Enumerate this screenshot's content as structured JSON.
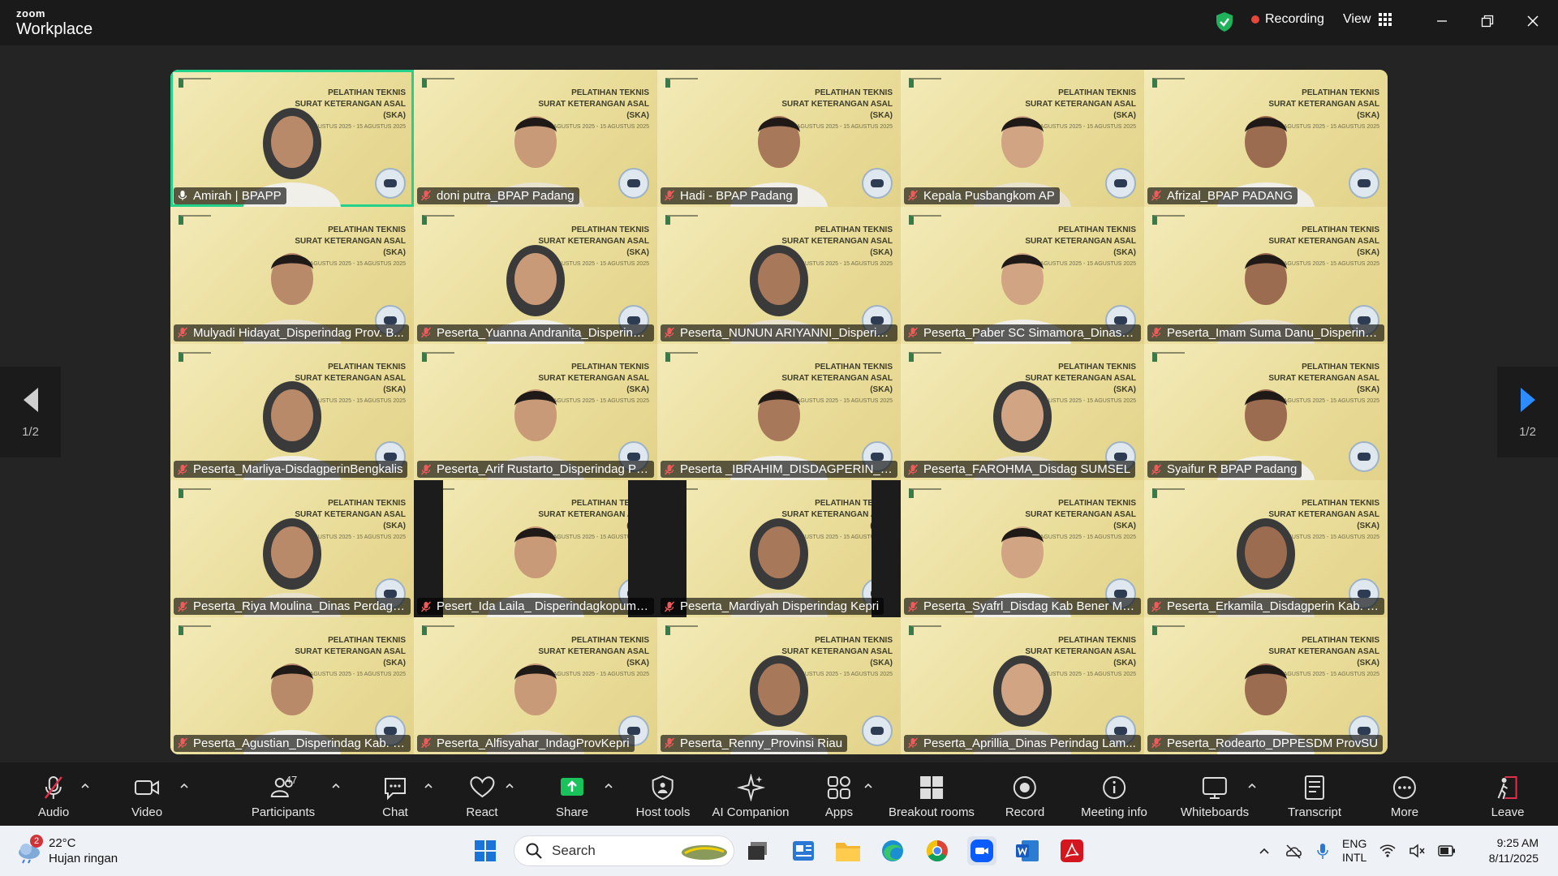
{
  "app": {
    "brand_top": "zoom",
    "brand_bottom": "Workplace"
  },
  "header": {
    "recording_label": "Recording",
    "view_label": "View"
  },
  "pager": {
    "left": "1/2",
    "right": "1/2"
  },
  "participants": [
    {
      "name": "Amirah | BPAPP",
      "speaking": true
    },
    {
      "name": "doni putra_BPAP Padang"
    },
    {
      "name": "Hadi - BPAP Padang"
    },
    {
      "name": "Kepala Pusbangkom AP"
    },
    {
      "name": "Afrizal_BPAP PADANG"
    },
    {
      "name": "Mulyadi Hidayat_Disperindag Prov. B..."
    },
    {
      "name": "Peserta_Yuanna Andranita_Disperind..."
    },
    {
      "name": "Peserta_NUNUN ARIYANNI_Disperin..."
    },
    {
      "name": "Peserta_Paber SC Simamora_Dinas K..."
    },
    {
      "name": "Peserta_Imam Suma Danu_Disperind..."
    },
    {
      "name": "Peserta_Marliya-DisdagperinBengkalis"
    },
    {
      "name": "Peserta_Arif Rustarto_Disperindag Pr..."
    },
    {
      "name": "Peserta _IBRAHIM_DISDAGPERIN_KA..."
    },
    {
      "name": "Peserta_FAROHMA_Disdag SUMSEL"
    },
    {
      "name": "Syaifur R BPAP Padang"
    },
    {
      "name": "Peserta_Riya Moulina_Dinas Perdagk..."
    },
    {
      "name": "Pesert_Ida Laila_ Disperindagkopum ..."
    },
    {
      "name": "Peserta_Mardiyah Disperindag Kepri"
    },
    {
      "name": "Peserta_Syafrl_Disdag Kab Bener Mer..."
    },
    {
      "name": "Peserta_Erkamila_Disdagperin Kab. B..."
    },
    {
      "name": "Peserta_Agustian_Disperindag Kab. Natu..."
    },
    {
      "name": "Peserta_Alfisyahar_IndagProvKepri"
    },
    {
      "name": "Peserta_Renny_Provinsi Riau"
    },
    {
      "name": "Peserta_Aprillia_Dinas Perindag Lam..."
    },
    {
      "name": "Peserta_Rodearto_DPPESDM ProvSU"
    }
  ],
  "banner": {
    "l1": "PELATIHAN TEKNIS",
    "l2": "SURAT KETERANGAN ASAL",
    "l3": "(SKA)",
    "l4": "11 AGUSTUS 2025 - 15 AGUSTUS 2025"
  },
  "toolbar": {
    "audio": "Audio",
    "video": "Video",
    "participants": "Participants",
    "participants_count": "47",
    "chat": "Chat",
    "react": "React",
    "share": "Share",
    "host_tools": "Host tools",
    "ai": "AI Companion",
    "apps": "Apps",
    "breakout": "Breakout rooms",
    "record": "Record",
    "meeting_info": "Meeting info",
    "whiteboards": "Whiteboards",
    "transcript": "Transcript",
    "more": "More",
    "leave": "Leave"
  },
  "taskbar": {
    "weather_temp": "22°C",
    "weather_desc": "Hujan ringan",
    "weather_badge": "2",
    "search_placeholder": "Search",
    "lang_1": "ENG",
    "lang_2": "INTL",
    "time": "9:25 AM",
    "date": "8/11/2025"
  },
  "colors": {
    "speaker_border": "#23d18b",
    "recording_dot": "#e5483b",
    "leave": "#e0304a",
    "share": "#19c25a"
  }
}
